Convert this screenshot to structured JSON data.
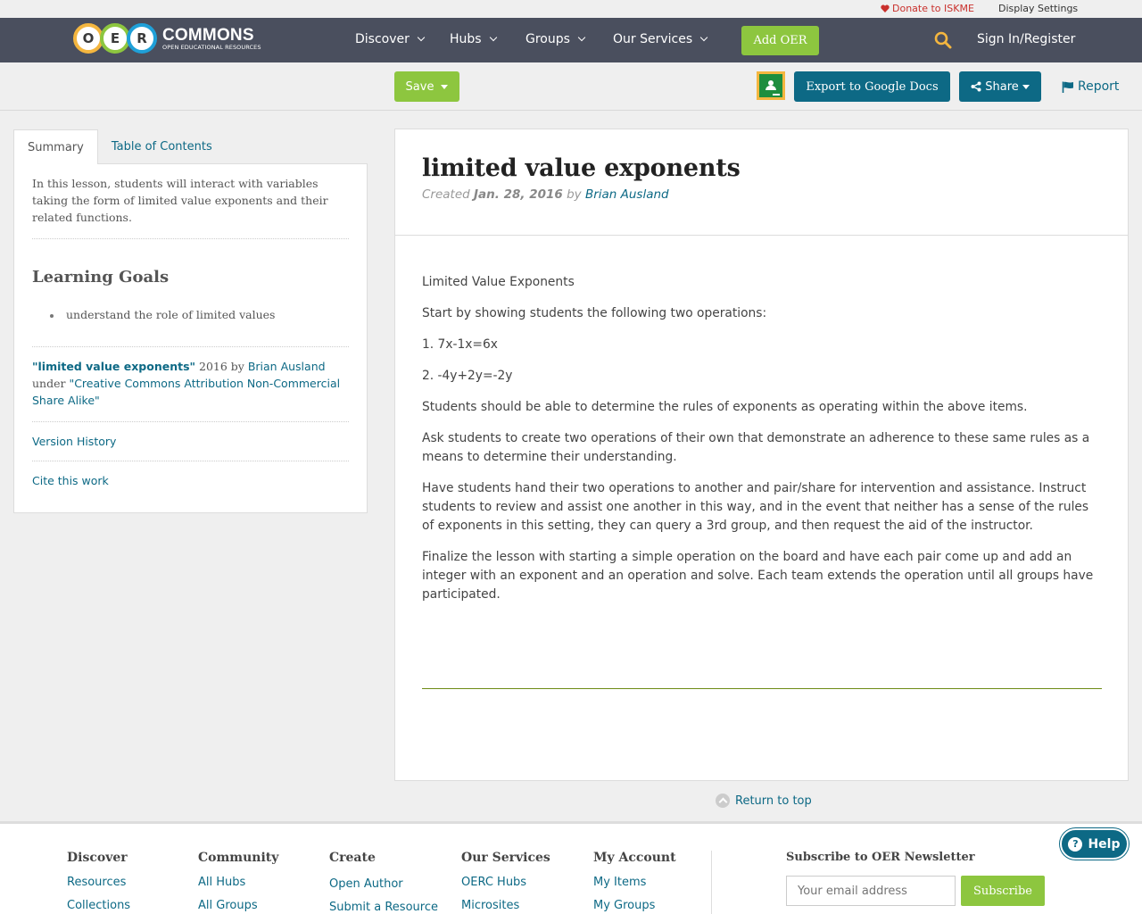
{
  "util": {
    "donate": "Donate to ISKME",
    "display_settings": "Display Settings"
  },
  "logo": {
    "letters": [
      "O",
      "E",
      "R"
    ],
    "brand": "COMMONS",
    "tagline": "OPEN EDUCATIONAL RESOURCES"
  },
  "nav": {
    "items": [
      {
        "label": "Discover"
      },
      {
        "label": "Hubs"
      },
      {
        "label": "Groups"
      },
      {
        "label": "Our Services"
      }
    ],
    "add_oer": "Add OER",
    "signin": "Sign In/Register"
  },
  "actions": {
    "save": "Save",
    "export": "Export to Google Docs",
    "share": "Share",
    "report": "Report"
  },
  "sidebar": {
    "tabs": [
      "Summary",
      "Table of Contents"
    ],
    "summary": "In this lesson, students will interact with variables taking the form of limited value exponents and their related functions.",
    "goals_title": "Learning Goals",
    "goals": [
      "understand the role of limited values"
    ],
    "attribution": {
      "title": "\"limited value exponents\"",
      "year": " 2016 by ",
      "author": "Brian Ausland",
      "under": "under ",
      "license": "\"Creative Commons Attribution Non-Commercial Share Alike\""
    },
    "version_history": "Version History",
    "cite": "Cite this work"
  },
  "main": {
    "title": "limited value exponents",
    "created_label": "Created ",
    "date": "Jan. 28, 2016",
    "by": " by ",
    "author": "Brian Ausland",
    "paragraphs": [
      "Limited Value Exponents",
      "Start by showing students the following two operations:",
      "1. 7x-1x=6x",
      "2. -4y+2y=-2y",
      "Students should be able to determine the rules of exponents as operating within the above items.",
      "Ask students to create two operations of their own that demonstrate an adherence to these same rules as a means to determine their understanding.",
      "Have students hand their two operations to another and pair/share for intervention and assistance. Instruct students to review and assist one another in this way, and in the event that neither has a sense of the rules of exponents in this setting, they can query a 3rd group, and then request the aid of the instructor.",
      "Finalize the lesson with starting a simple operation on the board and have each pair come up and add an integer with an exponent and an operation and solve. Each team extends the operation until all groups have participated."
    ]
  },
  "return_top": "Return to top",
  "footer": {
    "columns": [
      {
        "title": "Discover",
        "links": [
          "Resources",
          "Collections"
        ]
      },
      {
        "title": "Community",
        "links": [
          "All Hubs",
          "All Groups"
        ]
      },
      {
        "title": "Create",
        "links": [
          "Open Author",
          "Submit a Resource"
        ]
      },
      {
        "title": "Our Services",
        "links": [
          "OERC Hubs",
          "Microsites"
        ]
      },
      {
        "title": "My Account",
        "links": [
          "My Items",
          "My Groups"
        ]
      }
    ],
    "newsletter_title": "Subscribe to OER Newsletter",
    "email_placeholder": "Your email address",
    "subscribe": "Subscribe"
  },
  "help": "Help",
  "colors": {
    "nav_bg": "#4a4f5e",
    "accent_green": "#8dc63f",
    "accent_teal": "#0d6985",
    "donate_red": "#c9302c"
  }
}
